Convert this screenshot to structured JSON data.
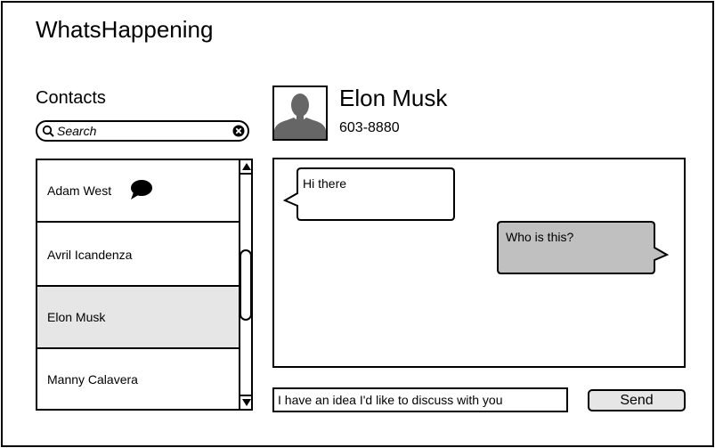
{
  "app": {
    "title": "WhatsHappening"
  },
  "contacts": {
    "heading": "Contacts",
    "search": {
      "placeholder": "Search",
      "value": ""
    },
    "items": [
      {
        "label": "Adam West",
        "selected": false,
        "has_unread_icon": true
      },
      {
        "label": "Avril Icandenza",
        "selected": false,
        "has_unread_icon": false
      },
      {
        "label": "Elon Musk",
        "selected": true,
        "has_unread_icon": false
      },
      {
        "label": "Manny Calavera",
        "selected": false,
        "has_unread_icon": false
      }
    ]
  },
  "active_contact": {
    "name": "Elon Musk",
    "phone": "603-8880"
  },
  "messages": [
    {
      "text": "Hi there",
      "direction": "incoming"
    },
    {
      "text": "Who is this?",
      "direction": "outgoing"
    }
  ],
  "composer": {
    "value": "I have an idea I'd like to discuss with you",
    "send_label": "Send"
  },
  "colors": {
    "selected_row": "#e6e6e6",
    "outgoing_bubble": "#c0c0c0",
    "avatar": "#666666"
  }
}
